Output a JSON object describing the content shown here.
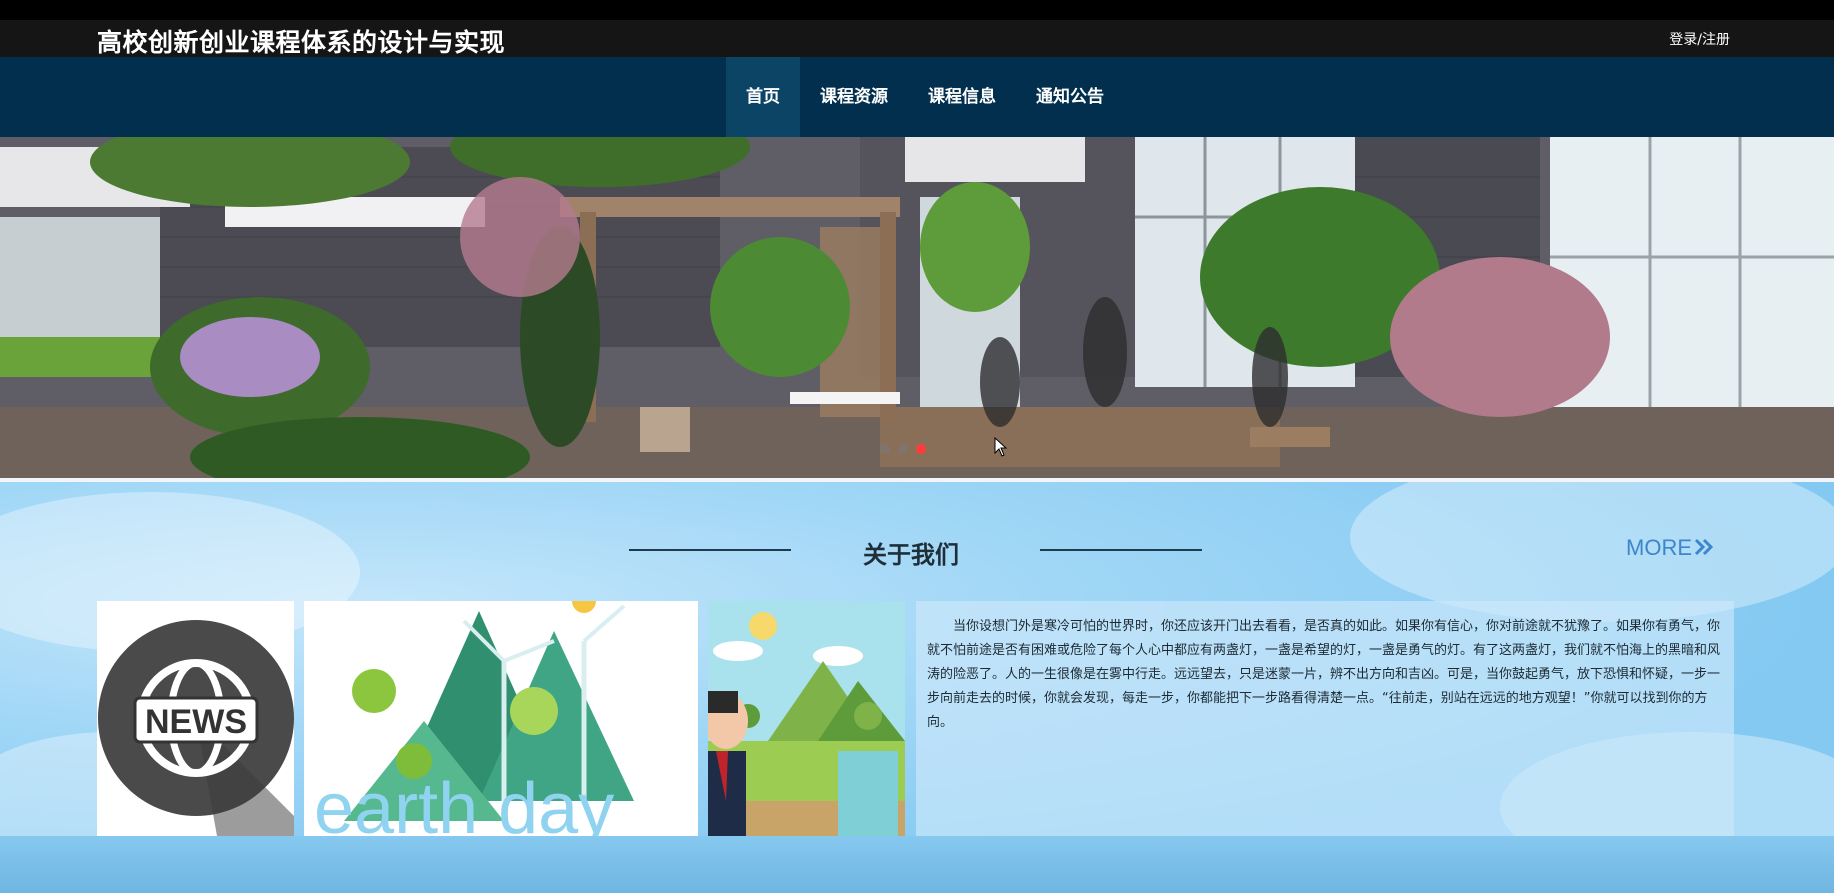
{
  "header": {
    "site_title": "高校创新创业课程体系的设计与实现",
    "login_label": "登录/注册"
  },
  "nav": {
    "items": [
      {
        "label": "首页",
        "active": true
      },
      {
        "label": "课程资源"
      },
      {
        "label": "课程信息"
      },
      {
        "label": "通知公告"
      }
    ]
  },
  "banner": {
    "slide_count": 3,
    "active_slide": 3
  },
  "about": {
    "title": "关于我们",
    "more_label": "MORE",
    "more_icon": "double-chevron-right-icon",
    "body": "当你设想门外是寒冷可怕的世界时，你还应该开门出去看看，是否真的如此。如果你有信心，你对前途就不犹豫了。如果你有勇气，你就不怕前途是否有困难或危险了每个人心中都应有两盏灯，一盏是希望的灯，一盏是勇气的灯。有了这两盏灯，我们就不怕海上的黑暗和风涛的险恶了。人的一生很像是在雾中行走。远远望去，只是迷蒙一片，辨不出方向和吉凶。可是，当你鼓起勇气，放下恐惧和怀疑，一步一步向前走去的时候，你就会发现，每走一步，你都能把下一步路看得清楚一点。“往前走，别站在远远的地方观望！”你就可以找到你的方向。",
    "images": [
      {
        "label": "NEWS",
        "icon": "globe-icon"
      },
      {
        "label": "earth day",
        "icon": "wind-turbine-icon"
      },
      {
        "icon": "landscape-icon"
      }
    ]
  },
  "colors": {
    "topbar": "#151515",
    "navbar": "#022f4d",
    "nav_active": "#0c4466",
    "content_bg": "#8fcdf3",
    "more_link": "#3d86cc",
    "active_dot": "#ff3b3b"
  }
}
